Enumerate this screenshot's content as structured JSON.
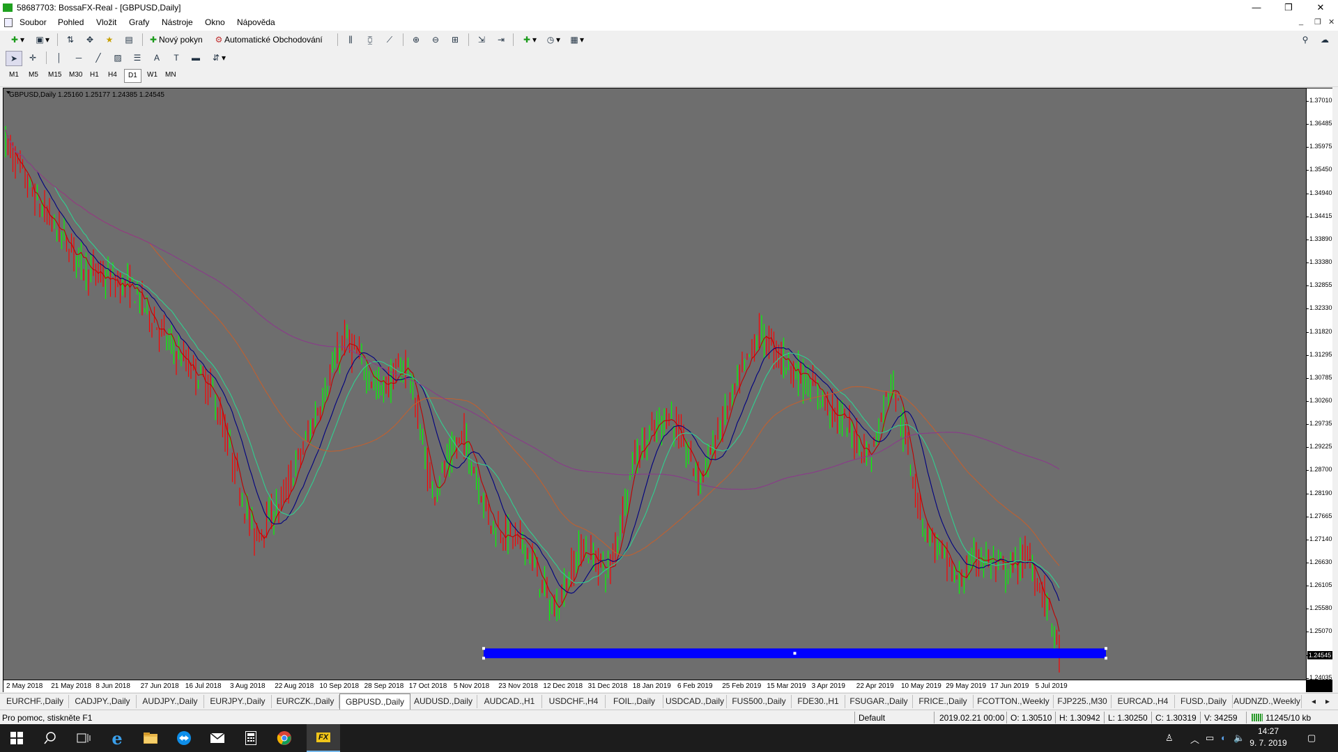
{
  "window": {
    "title": "58687703: BossaFX-Real - [GBPUSD,Daily]",
    "minimize": "—",
    "restore": "❐",
    "close": "✕"
  },
  "menu": {
    "items": [
      "Soubor",
      "Pohled",
      "Vložit",
      "Grafy",
      "Nástroje",
      "Okno",
      "Nápověda"
    ],
    "mdi_min": "_",
    "mdi_restore": "❐",
    "mdi_close": "✕"
  },
  "toolbar": {
    "new_order": "Nový pokyn",
    "auto_trading": "Automatické Obchodování"
  },
  "timeframes": {
    "items": [
      "M1",
      "M5",
      "M15",
      "M30",
      "H1",
      "H4",
      "D1",
      "W1",
      "MN"
    ],
    "active": "D1"
  },
  "chart": {
    "label": "GBPUSD,Daily  1.25160 1.25177 1.24385 1.24545",
    "current_price": "1.24545",
    "background": "#6e6e6e",
    "bull_color": "#00ff00",
    "bear_color": "#ff0000",
    "rectangle_color": "#0000ff",
    "price_labels": [
      "1.37010",
      "1.36485",
      "1.35975",
      "1.35450",
      "1.34940",
      "1.34415",
      "1.33890",
      "1.33380",
      "1.32855",
      "1.32330",
      "1.31820",
      "1.31295",
      "1.30785",
      "1.30260",
      "1.29735",
      "1.29225",
      "1.28700",
      "1.28190",
      "1.27665",
      "1.27140",
      "1.26630",
      "1.26105",
      "1.25580",
      "1.25070",
      "1.24545",
      "1.24035"
    ],
    "date_labels": [
      "2 May 2018",
      "21 May 2018",
      "8 Jun 2018",
      "27 Jun 2018",
      "16 Jul 2018",
      "3 Aug 2018",
      "22 Aug 2018",
      "10 Sep 2018",
      "28 Sep 2018",
      "17 Oct 2018",
      "5 Nov 2018",
      "23 Nov 2018",
      "12 Dec 2018",
      "31 Dec 2018",
      "18 Jan 2019",
      "6 Feb 2019",
      "25 Feb 2019",
      "15 Mar 2019",
      "3 Apr 2019",
      "22 Apr 2019",
      "10 May 2019",
      "29 May 2019",
      "17 Jun 2019",
      "5 Jul 2019"
    ]
  },
  "tabs": {
    "items": [
      "EURCHF.,Daily",
      "CADJPY.,Daily",
      "AUDJPY.,Daily",
      "EURJPY.,Daily",
      "EURCZK.,Daily",
      "GBPUSD.,Daily",
      "AUDUSD.,Daily",
      "AUDCAD.,H1",
      "USDCHF.,H4",
      "FOIL.,Daily",
      "USDCAD.,Daily",
      "FUS500.,Daily",
      "FDE30.,H1",
      "FSUGAR.,Daily",
      "FRICE.,Daily",
      "FCOTTON.,Weekly",
      "FJP225.,M30",
      "EURCAD.,H4",
      "FUSD.,Daily",
      "AUDNZD.,Weekly"
    ],
    "active": "GBPUSD.,Daily",
    "scroll_left": "◂",
    "scroll_right": "▸"
  },
  "status": {
    "help": "Pro pomoc, stiskněte F1",
    "profile": "Default",
    "datetime": "2019.02.21 00:00",
    "open": "O: 1.30510",
    "high": "H: 1.30942",
    "low": "L: 1.30250",
    "close": "C: 1.30319",
    "volume": "V: 34259",
    "traffic": "11245/10 kb"
  },
  "taskbar": {
    "time": "14:27",
    "date": "9. 7. 2019"
  }
}
